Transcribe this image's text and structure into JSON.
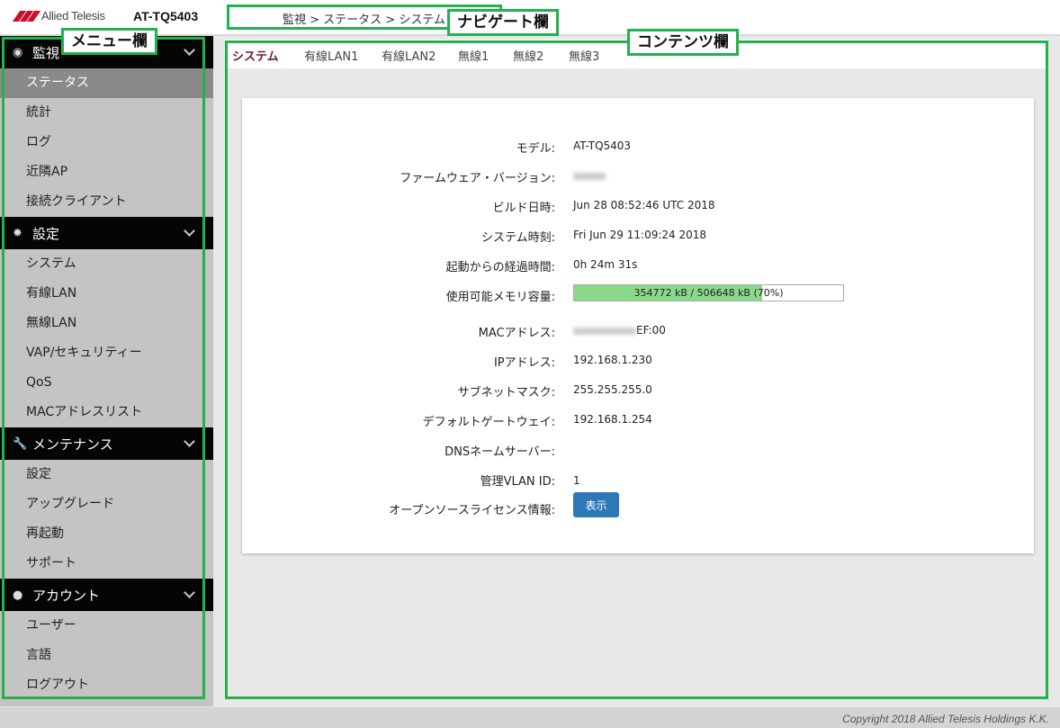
{
  "header": {
    "brand": "Allied Telesis",
    "model": "AT-TQ5403",
    "breadcrumb": "監視 > ステータス > システム"
  },
  "annotations": {
    "nav": "ナビゲート欄",
    "menu": "メニュー欄",
    "contents": "コンテンツ欄",
    "color": "#22b14c"
  },
  "sidebar": {
    "sections": [
      {
        "title": "監視",
        "icon": "eye-icon",
        "items": [
          "ステータス",
          "統計",
          "ログ",
          "近隣AP",
          "接続クライアント"
        ]
      },
      {
        "title": "設定",
        "icon": "gear-icon",
        "items": [
          "システム",
          "有線LAN",
          "無線LAN",
          "VAP/セキュリティー",
          "QoS",
          "MACアドレスリスト"
        ]
      },
      {
        "title": "メンテナンス",
        "icon": "wrench-icon",
        "items": [
          "設定",
          "アップグレード",
          "再起動",
          "サポート"
        ]
      },
      {
        "title": "アカウント",
        "icon": "user-icon",
        "items": [
          "ユーザー",
          "言語",
          "ログアウト"
        ]
      }
    ],
    "active_item": "ステータス"
  },
  "tabs": [
    "システム",
    "有線LAN1",
    "有線LAN2",
    "無線1",
    "無線2",
    "無線3"
  ],
  "active_tab": "システム",
  "system": {
    "model_label": "モデル:",
    "model_value": "AT-TQ5403",
    "firmware_label": "ファームウェア・バージョン:",
    "build_label": "ビルド日時:",
    "build_value": "Jun 28 08:52:46 UTC 2018",
    "time_label": "システム時刻:",
    "time_value": "Fri Jun 29 11:09:24 2018",
    "uptime_label": "起動からの経過時間:",
    "uptime_value": "0h 24m 31s",
    "memory_label": "使用可能メモリ容量:",
    "memory_value": "354772 kB / 506648 kB (70%)",
    "memory_fraction": 0.7,
    "mac_label": "MACアドレス:",
    "mac_suffix": "EF:00",
    "ip_label": "IPアドレス:",
    "ip_value": "192.168.1.230",
    "subnet_label": "サブネットマスク:",
    "subnet_value": "255.255.255.0",
    "gateway_label": "デフォルトゲートウェイ:",
    "gateway_value": "192.168.1.254",
    "dns_label": "DNSネームサーバー:",
    "vlan_label": "管理VLAN ID:",
    "vlan_value": "1",
    "license_label": "オープンソースライセンス情報:",
    "license_button": "表示"
  },
  "footer": {
    "copyright": "Copyright 2018 Allied Telesis Holdings K.K."
  }
}
